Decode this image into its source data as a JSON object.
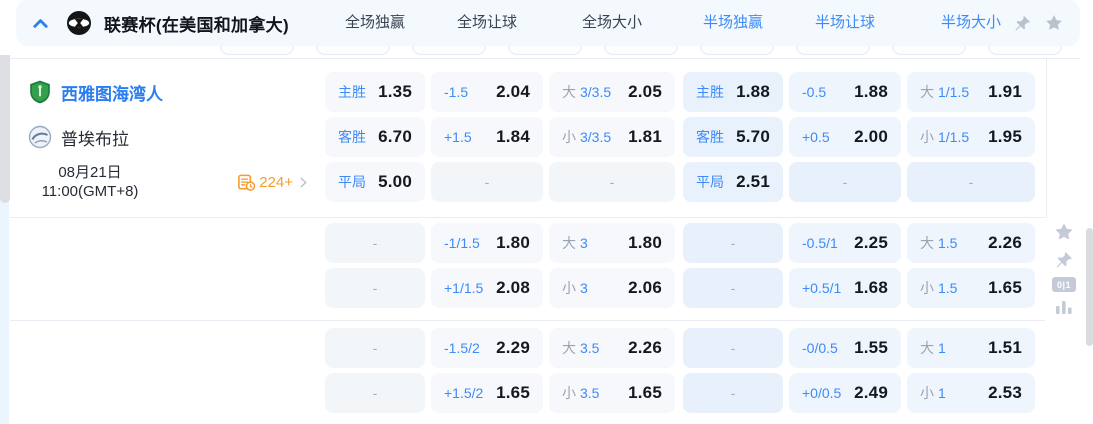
{
  "colors": {
    "accent_blue": "#3d8bf8",
    "accent_orange": "#f59d2c",
    "odds_text": "#14181f",
    "header_bg": "#f4f9fe",
    "half_cell_bg": "#e9f2fc"
  },
  "header": {
    "title": "联赛杯(在美国和加拿大)",
    "columns": [
      "全场独赢",
      "全场让球",
      "全场大小",
      "半场独赢",
      "半场让球",
      "半场大小"
    ],
    "icons": [
      "chevron-up-icon",
      "league-logo",
      "pushpin-icon",
      "star-icon"
    ]
  },
  "match": {
    "home_team": "西雅图海湾人",
    "away_team": "普埃布拉",
    "date": "08月21日",
    "time": "11:00(GMT+8)",
    "markets_count": "224+"
  },
  "sidebar": {
    "badge_text": "0|1",
    "icons": [
      "star-icon",
      "pushpin-icon",
      "score-01-icon",
      "stats-bars-icon"
    ]
  },
  "odds": {
    "dash": "-",
    "groups": [
      [
        [
          {
            "label": "主胜",
            "value": "1.35"
          },
          {
            "label": "-1.5",
            "value": "2.04"
          },
          {
            "prefix": "大",
            "label": "3/3.5",
            "value": "2.05"
          },
          {
            "label": "主胜",
            "value": "1.88"
          },
          {
            "label": "-0.5",
            "value": "1.88"
          },
          {
            "prefix": "大",
            "label": "1/1.5",
            "value": "1.91"
          }
        ],
        [
          {
            "label": "客胜",
            "value": "6.70"
          },
          {
            "label": "+1.5",
            "value": "1.84"
          },
          {
            "prefix": "小",
            "label": "3/3.5",
            "value": "1.81"
          },
          {
            "label": "客胜",
            "value": "5.70"
          },
          {
            "label": "+0.5",
            "value": "2.00"
          },
          {
            "prefix": "小",
            "label": "1/1.5",
            "value": "1.95"
          }
        ],
        [
          {
            "label": "平局",
            "value": "5.00"
          },
          {
            "dash": true
          },
          {
            "dash": true
          },
          {
            "label": "平局",
            "value": "2.51"
          },
          {
            "dash": true
          },
          {
            "dash": true
          }
        ]
      ],
      [
        [
          {
            "dash": true
          },
          {
            "label": "-1/1.5",
            "value": "1.80"
          },
          {
            "prefix": "大",
            "label": "3",
            "value": "1.80"
          },
          {
            "dash": true
          },
          {
            "label": "-0.5/1",
            "value": "2.25"
          },
          {
            "prefix": "大",
            "label": "1.5",
            "value": "2.26"
          }
        ],
        [
          {
            "dash": true
          },
          {
            "label": "+1/1.5",
            "value": "2.08"
          },
          {
            "prefix": "小",
            "label": "3",
            "value": "2.06"
          },
          {
            "dash": true
          },
          {
            "label": "+0.5/1",
            "value": "1.68"
          },
          {
            "prefix": "小",
            "label": "1.5",
            "value": "1.65"
          }
        ]
      ],
      [
        [
          {
            "dash": true
          },
          {
            "label": "-1.5/2",
            "value": "2.29"
          },
          {
            "prefix": "大",
            "label": "3.5",
            "value": "2.26"
          },
          {
            "dash": true
          },
          {
            "label": "-0/0.5",
            "value": "1.55"
          },
          {
            "prefix": "大",
            "label": "1",
            "value": "1.51"
          }
        ],
        [
          {
            "dash": true
          },
          {
            "label": "+1.5/2",
            "value": "1.65"
          },
          {
            "prefix": "小",
            "label": "3.5",
            "value": "1.65"
          },
          {
            "dash": true
          },
          {
            "label": "+0/0.5",
            "value": "2.49"
          },
          {
            "prefix": "小",
            "label": "1",
            "value": "2.53"
          }
        ]
      ]
    ]
  }
}
